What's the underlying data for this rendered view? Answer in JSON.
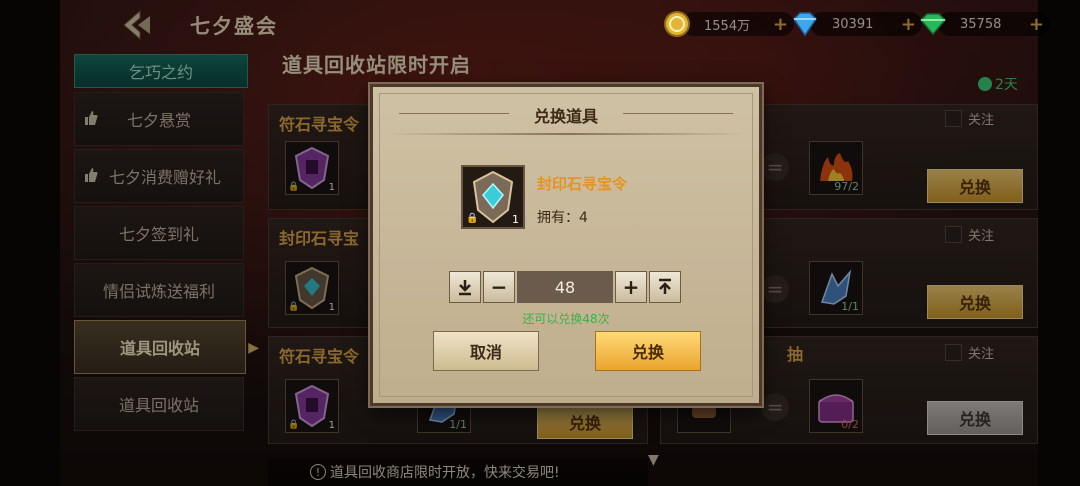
{
  "header": {
    "title": "七夕盛会",
    "currencies": [
      {
        "icon": "gold-coin-icon",
        "value": "1554万"
      },
      {
        "icon": "blue-diamond-icon",
        "value": "30391"
      },
      {
        "icon": "green-gem-icon",
        "value": "35758"
      }
    ]
  },
  "nav": {
    "header": "乞巧之约",
    "items": [
      {
        "label": "七夕悬赏"
      },
      {
        "label": "七夕消费赠好礼"
      },
      {
        "label": "七夕签到礼"
      },
      {
        "label": "情侣试炼送福利"
      },
      {
        "label": "道具回收站"
      },
      {
        "label": "道具回收站"
      }
    ]
  },
  "main": {
    "title": "道具回收站限时开启",
    "timer": "2天",
    "follow_label": "关注",
    "cards": [
      {
        "title": "符石寻宝令",
        "left_count": "1",
        "right_count": "97/2",
        "button": "兑换"
      },
      {
        "title": "封印石寻宝",
        "left_count": "1",
        "right_count": "1/1",
        "button": "兑换"
      },
      {
        "title": "符石寻宝令",
        "left_count": "1",
        "mid_count": "1/1",
        "mid_button": "兑换",
        "right_title": "抽",
        "right_count": "0/2",
        "button": "兑换"
      }
    ],
    "bottom_tip": "道具回收商店限时开放，快来交易吧!"
  },
  "dialog": {
    "title": "兑换道具",
    "item_name": "封印石寻宝令",
    "item_count": "1",
    "owned": "拥有：4",
    "quantity": "48",
    "hint": "还可以兑换48次",
    "cancel": "取消",
    "confirm": "兑换"
  }
}
